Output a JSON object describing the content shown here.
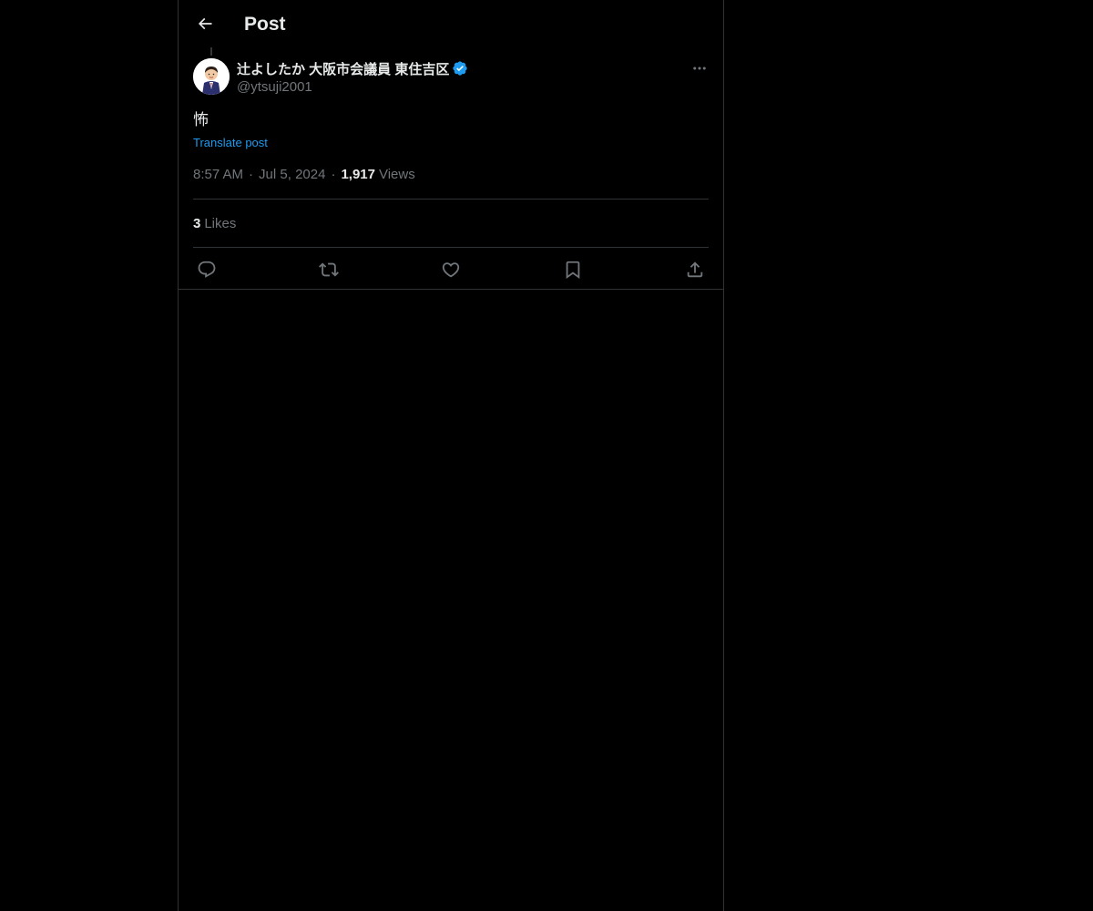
{
  "header": {
    "title": "Post"
  },
  "post": {
    "author": {
      "display_name": "辻よしたか 大阪市会議員 東住吉区",
      "handle": "@ytsuji2001",
      "verified": true
    },
    "text": "怖",
    "translate_label": "Translate post",
    "time": "8:57 AM",
    "date": "Jul 5, 2024",
    "separator": "·",
    "views_count": "1,917",
    "views_label": "Views",
    "likes_count": "3",
    "likes_label": "Likes"
  },
  "colors": {
    "background": "#000000",
    "text_primary": "#e7e9ea",
    "text_secondary": "#71767b",
    "accent": "#1d9bf0",
    "border": "#2f3336"
  },
  "icons": {
    "back": "arrow-left-icon",
    "verified": "verified-badge-icon",
    "more": "more-horizontal-icon",
    "reply": "reply-icon",
    "repost": "repost-icon",
    "like": "heart-icon",
    "bookmark": "bookmark-icon",
    "share": "share-icon"
  }
}
